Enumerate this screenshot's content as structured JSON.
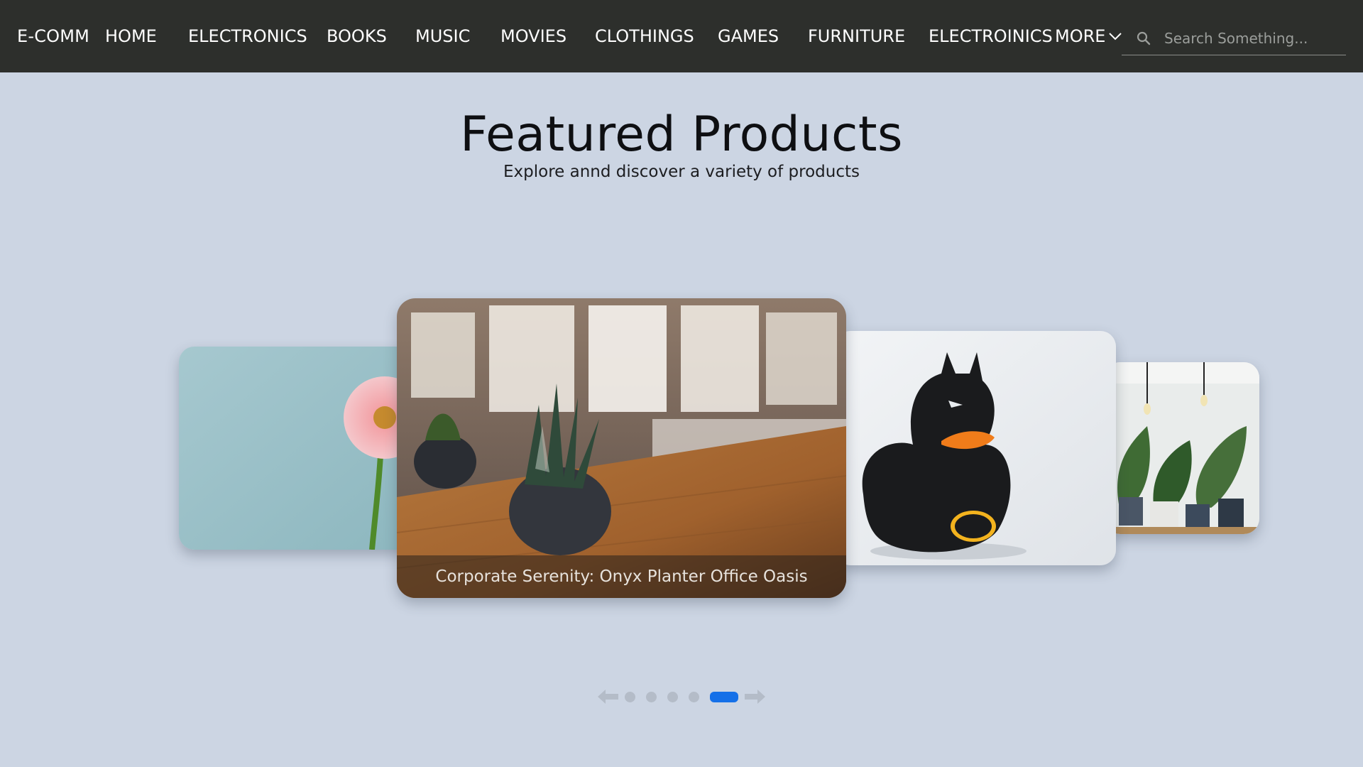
{
  "nav": {
    "brand": "E-COMM",
    "items": [
      {
        "label": "HOME"
      },
      {
        "label": "ELECTRONICS"
      },
      {
        "label": "BOOKS"
      },
      {
        "label": "MUSIC"
      },
      {
        "label": "MOVIES"
      },
      {
        "label": "CLOTHINGS"
      },
      {
        "label": "GAMES"
      },
      {
        "label": "FURNITURE"
      },
      {
        "label": "ELECTROINICS"
      }
    ],
    "more_label": "MORE",
    "search": {
      "placeholder": "Search Something..."
    }
  },
  "hero": {
    "title": "Featured Products",
    "subtitle": "Explore annd discover a variety of products"
  },
  "carousel": {
    "caption": "Corporate Serenity: Onyx Planter Office Oasis",
    "dots_count": 5,
    "active_index": 4
  },
  "colors": {
    "navbar_bg": "#2d2f2c",
    "page_bg": "#ccd5e3",
    "active_dot": "#1570e8",
    "inactive_dot": "#b4bcc8"
  },
  "icons": {
    "search": "search-icon",
    "more": "chevron-down-icon",
    "prev": "arrow-left-icon",
    "next": "arrow-right-icon"
  }
}
